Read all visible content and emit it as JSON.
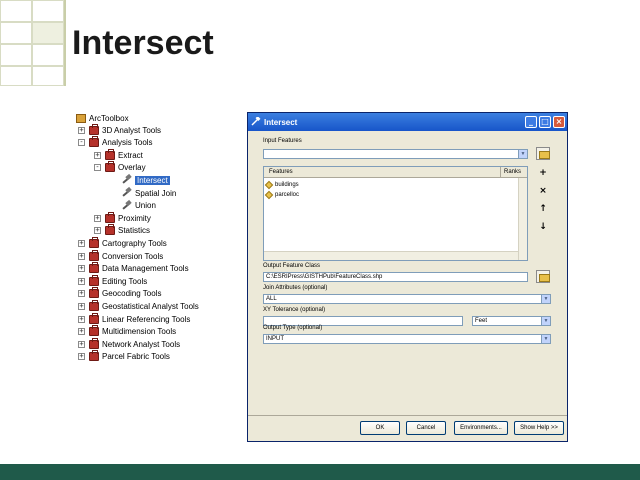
{
  "slide": {
    "title": "Intersect",
    "colors": {
      "bottom_bar": "#1f5a4a",
      "title": "#1a1a1a"
    }
  },
  "toolbox": {
    "root": "ArcToolbox",
    "items": [
      {
        "label": "3D Analyst Tools",
        "level": 1,
        "expander": "+",
        "icon": "toolbox-icon"
      },
      {
        "label": "Analysis Tools",
        "level": 1,
        "expander": "-",
        "icon": "toolbox-icon"
      },
      {
        "label": "Extract",
        "level": 2,
        "expander": "+",
        "icon": "toolset-icon"
      },
      {
        "label": "Overlay",
        "level": 2,
        "expander": "-",
        "icon": "toolset-icon"
      },
      {
        "label": "Intersect",
        "level": 3,
        "expander": "",
        "icon": "tool-icon",
        "selected": true
      },
      {
        "label": "Spatial Join",
        "level": 3,
        "expander": "",
        "icon": "tool-icon"
      },
      {
        "label": "Union",
        "level": 3,
        "expander": "",
        "icon": "tool-icon"
      },
      {
        "label": "Proximity",
        "level": 2,
        "expander": "+",
        "icon": "toolset-icon"
      },
      {
        "label": "Statistics",
        "level": 2,
        "expander": "+",
        "icon": "toolset-icon"
      },
      {
        "label": "Cartography Tools",
        "level": 1,
        "expander": "+",
        "icon": "toolbox-icon"
      },
      {
        "label": "Conversion Tools",
        "level": 1,
        "expander": "+",
        "icon": "toolbox-icon"
      },
      {
        "label": "Data Management Tools",
        "level": 1,
        "expander": "+",
        "icon": "toolbox-icon"
      },
      {
        "label": "Editing Tools",
        "level": 1,
        "expander": "+",
        "icon": "toolbox-icon"
      },
      {
        "label": "Geocoding Tools",
        "level": 1,
        "expander": "+",
        "icon": "toolbox-icon"
      },
      {
        "label": "Geostatistical Analyst Tools",
        "level": 1,
        "expander": "+",
        "icon": "toolbox-icon"
      },
      {
        "label": "Linear Referencing Tools",
        "level": 1,
        "expander": "+",
        "icon": "toolbox-icon"
      },
      {
        "label": "Multidimension Tools",
        "level": 1,
        "expander": "+",
        "icon": "toolbox-icon"
      },
      {
        "label": "Network Analyst Tools",
        "level": 1,
        "expander": "+",
        "icon": "toolbox-icon"
      },
      {
        "label": "Parcel Fabric Tools",
        "level": 1,
        "expander": "+",
        "icon": "toolbox-icon"
      }
    ]
  },
  "dialog": {
    "title": "Intersect",
    "window_buttons": {
      "minimize": "_",
      "maximize": "□",
      "close": "×"
    },
    "input_features_label": "Input Features",
    "input_features_value": "",
    "features_table": {
      "col_features": "Features",
      "col_ranks": "Ranks",
      "rows": [
        "buildings",
        "parcelloc"
      ]
    },
    "side_buttons": {
      "add": "+",
      "remove": "×",
      "up": "↑",
      "down": "↓"
    },
    "output_label": "Output Feature Class",
    "output_value": "C:\\ESRIPress\\GISTHPub\\FeatureClass.shp",
    "join_attributes_label": "Join Attributes (optional)",
    "join_attributes_value": "ALL",
    "xy_tolerance_label": "XY Tolerance (optional)",
    "xy_tolerance_value": "",
    "xy_tolerance_units": "Feet",
    "output_type_label": "Output Type (optional)",
    "output_type_value": "INPUT",
    "buttons": {
      "ok": "OK",
      "cancel": "Cancel",
      "environments": "Environments...",
      "show_help": "Show Help >>"
    }
  }
}
